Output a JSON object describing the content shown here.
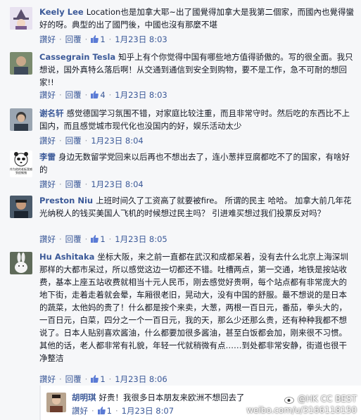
{
  "comments": [
    {
      "name": "Keely Lee",
      "text": "Location也是加拿大耶~出了國覺得加拿大是我第二個家，而國內也覺得蠻好的呀。典型的出了國門後，中國也沒有那麼不堪",
      "actions": [
        "讚好",
        "回覆"
      ],
      "likes": "1",
      "date": "1月23日 8:03"
    },
    {
      "name": "Cassegrain Tesla",
      "text": "知乎上有个你觉得中国有哪些地方值得骄傲的。写的很全面。我只想说，国外真特么落后啊！从交通到通信到安全到购物，要不是工作，急不可耐的想回家!!",
      "actions": [
        "讚好",
        "回覆"
      ],
      "likes": "4",
      "date": "1月23日 8:03"
    },
    {
      "name": "谢名轩",
      "text": "感觉德国学习氛围不错，对家庭比较注重，而且非常守时。然后吃的东西比不上国内，而且感觉城市现代化也没国内的好，娱乐活动太少",
      "actions": [
        "讚好",
        "回覆"
      ],
      "likes": "",
      "date": "1月23日 8:04"
    },
    {
      "name": "李雷",
      "text": "身边无数留学党回来以后再也不想出去了，连小葱拌豆腐都吃不了的国家，有啥好的",
      "actions": [
        "讚好",
        "回覆"
      ],
      "likes": "",
      "date": "1月23日 8:04",
      "avatar_caption": "作为他的老板我感到很惭愧"
    },
    {
      "name": "Preston Niu",
      "text": "上班时间久了工资高了就要被fire。 所谓的民主 哈哈。 加拿大前几年花光纳税人的钱买美国人飞机的时候想过民主吗？ 引进难买想过我们投票反对吗？",
      "actions": [
        "讚好",
        "回覆"
      ],
      "likes": "1",
      "date": "1月23日 8:05"
    },
    {
      "name": "Hu Ashitaka",
      "text": "坐标大阪，来之前一直都在武汉和成都呆着，没有去什么北京上海深圳那样的大都市呆过，所以感觉这边一切都还不错。吐槽两点，第一交通，地铁是按站收费，基本上座五站收费就相当十元人民币，刚去感觉好贵啊，每个站点都有非常庞大的地下街，走着走着就会晕，车厢很老旧，晃动大，没有中国的舒服。最不想说的是日本的蔬菜，太他妈的贵了！什么都是按个来卖，大葱，两根一百日元，番茄，拳头大的，一百日元，白菜，四分之一个一百日元，我的天，那么少还那么贵，还有种种我都不想说了。日本人贴别喜欢酱油，什么都要加很多酱油，甚至白饭都会加，刚来很不习惯。其他的话，老人都非常有礼貌，年轻一代就稍微有点……到处都非常安静，街道也很干净整洁",
      "actions": [
        "讚好",
        "回覆"
      ],
      "likes": "1",
      "date": "1月23日 8:06"
    }
  ],
  "reply": {
    "name": "胡明琪",
    "text": "好贵！我很多日本朋友来欧洲不想回去了",
    "actions": [
      "讚好"
    ],
    "likes": "1",
    "date": "1月23日 8:07"
  },
  "watermark": {
    "line1": "@HK CC BEST",
    "line2": "weibo.com/u/3166118150"
  },
  "colors": {
    "link": "#3b5998",
    "meta": "#9197a3",
    "text": "#141823",
    "background": "#f6f7f9"
  }
}
